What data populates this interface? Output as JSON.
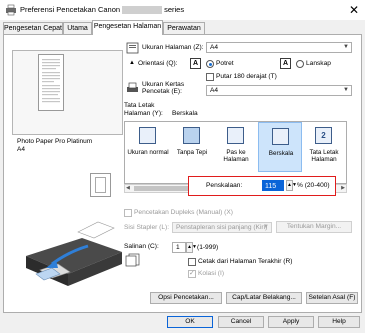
{
  "window": {
    "title_prefix": "Preferensi Pencetakan Canon",
    "title_suffix": "series",
    "close_glyph": "✕"
  },
  "tabs": [
    {
      "label": "Pengesetan Cepat"
    },
    {
      "label": "Utama"
    },
    {
      "label": "Pengesetan Halaman"
    },
    {
      "label": "Perawatan"
    }
  ],
  "preview": {
    "media_line1": "Photo Paper Pro Platinum",
    "media_line2": "A4"
  },
  "page_setup": {
    "page_size_label": "Ukuran Halaman (Z):",
    "page_size_value": "A4",
    "orientation_label": "Orientasi (Q):",
    "portrait_label": "Potret",
    "landscape_label": "Lanskap",
    "orientation_selected": "Potret",
    "rotate_label": "Putar 180 derajat (T)",
    "printer_paper_label_1": "Ukuran Kertas",
    "printer_paper_label_2": "Pencetak (E):",
    "printer_paper_value": "A4",
    "layout_label_1": "Tata Letak",
    "layout_label_2": "Halaman (Y):",
    "layout_current": "Berskala",
    "layout_items": [
      {
        "label": "Ukuran normal",
        "selected": false
      },
      {
        "label": "Tanpa Tepi",
        "selected": false
      },
      {
        "label": "Pas ke Halaman",
        "selected": false
      },
      {
        "label": "Berskala",
        "selected": true
      },
      {
        "label": "Tata Letak Halaman",
        "selected": false
      }
    ],
    "scaling_label": "Penskalaan:",
    "scaling_value": "115",
    "scaling_range": "% (20-400)",
    "duplex_label": "Pencetakan Dupleks (Manual) (X)",
    "stapling_label": "Sisi Stapler (L):",
    "stapling_value": "Penstapleran sisi panjang (Kiri)",
    "margin_button": "Tentukan Margin...",
    "copies_label": "Salinan (C):",
    "copies_value": "1",
    "copies_range": "(1-999)",
    "last_page_label": "Cetak dari Halaman Terakhir (R)",
    "collate_label": "Kolasi (I)"
  },
  "buttons": {
    "print_options": "Opsi Pencetakan...",
    "stamp": "Cap/Latar Belakang...",
    "defaults": "Setelan Asal (F)",
    "ok": "OK",
    "cancel": "Cancel",
    "apply": "Apply",
    "help": "Help"
  },
  "orientation_icon_text": "A"
}
